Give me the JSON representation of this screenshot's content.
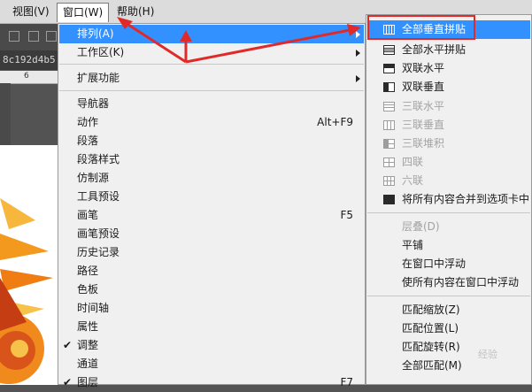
{
  "menubar": {
    "items": [
      {
        "label": "视图(V)"
      },
      {
        "label": "窗口(W)"
      },
      {
        "label": "帮助(H)"
      }
    ]
  },
  "document": {
    "tab_text": "8c192d4b5",
    "ruler_tick": "6"
  },
  "main_menu": {
    "items": [
      {
        "label": "排列(A)",
        "submenu": true
      },
      {
        "label": "工作区(K)",
        "submenu": true
      },
      {
        "label": "扩展功能",
        "submenu": true
      },
      {
        "label": "导航器"
      },
      {
        "label": "动作",
        "shortcut": "Alt+F9"
      },
      {
        "label": "段落"
      },
      {
        "label": "段落样式"
      },
      {
        "label": "仿制源"
      },
      {
        "label": "工具预设"
      },
      {
        "label": "画笔",
        "shortcut": "F5"
      },
      {
        "label": "画笔预设"
      },
      {
        "label": "历史记录"
      },
      {
        "label": "路径"
      },
      {
        "label": "色板"
      },
      {
        "label": "时间轴"
      },
      {
        "label": "属性"
      },
      {
        "label": "调整",
        "checked": true
      },
      {
        "label": "通道"
      },
      {
        "label": "图层",
        "checked": true,
        "shortcut": "F7"
      }
    ],
    "check_glyph": "✔"
  },
  "sub_menu": {
    "items": [
      {
        "label": "全部垂直拼贴",
        "icon": "tile-vertical-icon"
      },
      {
        "label": "全部水平拼贴",
        "icon": "tile-horizontal-icon"
      },
      {
        "label": "双联水平",
        "icon": "two-up-horizontal-icon"
      },
      {
        "label": "双联垂直",
        "icon": "two-up-vertical-icon"
      },
      {
        "label": "三联水平",
        "icon": "three-up-horizontal-icon",
        "disabled": true
      },
      {
        "label": "三联垂直",
        "icon": "three-up-vertical-icon",
        "disabled": true
      },
      {
        "label": "三联堆积",
        "icon": "three-up-stacked-icon",
        "disabled": true
      },
      {
        "label": "四联",
        "icon": "four-up-icon",
        "disabled": true
      },
      {
        "label": "六联",
        "icon": "six-up-icon",
        "disabled": true
      },
      {
        "label": "将所有内容合并到选项卡中",
        "icon": "consolidate-tabs-icon"
      },
      {
        "label": "层叠(D)",
        "disabled": true
      },
      {
        "label": "平铺"
      },
      {
        "label": "在窗口中浮动"
      },
      {
        "label": "使所有内容在窗口中浮动"
      },
      {
        "label": "匹配缩放(Z)"
      },
      {
        "label": "匹配位置(L)"
      },
      {
        "label": "匹配旋转(R)"
      },
      {
        "label": "全部匹配(M)"
      }
    ]
  },
  "watermark": "经验",
  "colors": {
    "highlight": "#3390ff",
    "annotation_red": "#e02a2a"
  }
}
